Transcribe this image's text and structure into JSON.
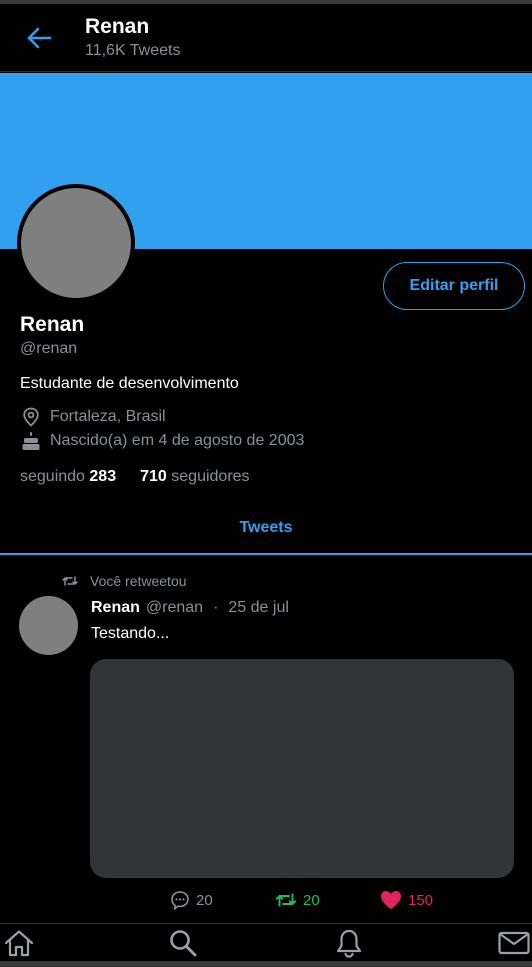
{
  "header": {
    "name": "Renan",
    "tweet_count": "11,6K Tweets",
    "back_icon": "arrow-left-icon"
  },
  "colors": {
    "accent": "#31a0ef",
    "background": "#000000",
    "muted": "#8b9096",
    "retweet": "#17bf63",
    "like": "#e0245e",
    "media_placeholder": "#323538",
    "avatar_placeholder": "#7f7f7f"
  },
  "profile": {
    "edit_label": "Editar perfil",
    "name": "Renan",
    "handle": "@renan",
    "bio": "Estudante de desenvolvimento",
    "location": "Fortaleza, Brasil",
    "birth": "Nascido(a) em 4 de agosto de 2003",
    "following_label": "seguindo",
    "following_count": "283",
    "followers_count": "710",
    "followers_label": "seguidores"
  },
  "tabs": {
    "active": "Tweets"
  },
  "tweet": {
    "retweet_notice": "Você retweetou",
    "author_name": "Renan",
    "author_handle": "@renan",
    "separator": "·",
    "date": "25 de jul",
    "text": "Testando...",
    "replies": "20",
    "retweets": "20",
    "likes": "150"
  },
  "nav": {
    "items": [
      "home-icon",
      "search-icon",
      "bell-icon",
      "mail-icon"
    ]
  }
}
